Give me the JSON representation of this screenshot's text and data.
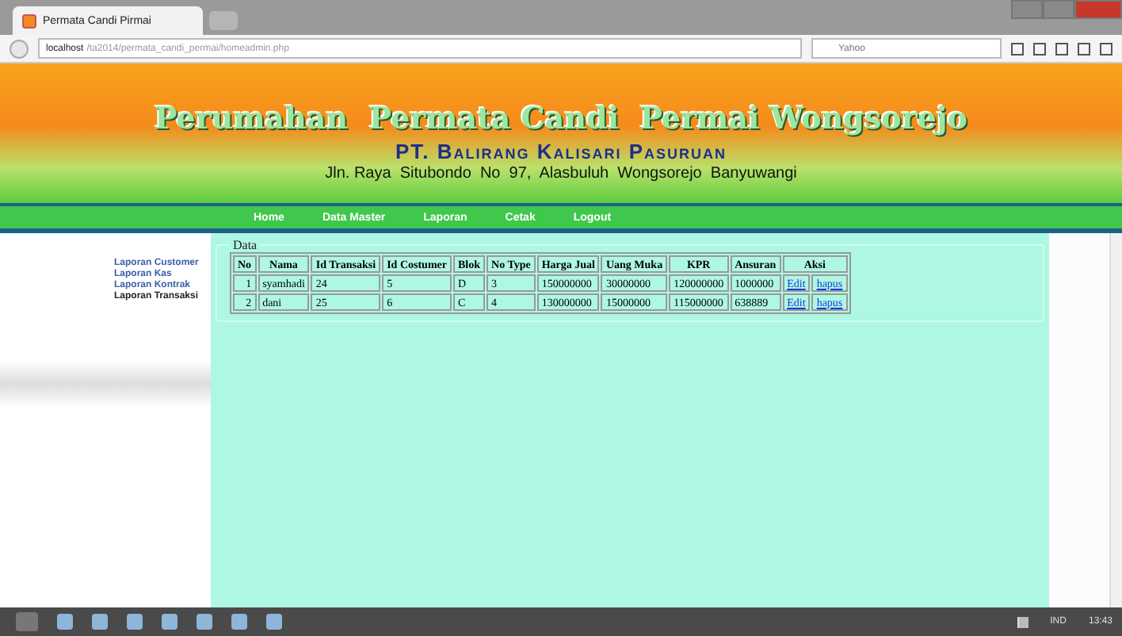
{
  "browser": {
    "tab_title": "Permata Candi Pirmai",
    "url_host": "localhost",
    "url_path": "/ta2014/permata_candi_permai/homeadmin.php",
    "search_placeholder": "Yahoo"
  },
  "banner": {
    "title": "Perumahan  Permata Candi  Permai Wongsorejo",
    "company": "PT. Balirang Kalisari Pasuruan",
    "address": "Jln. Raya  Situbondo  No  97,  Alasbuluh  Wongsorejo  Banyuwangi"
  },
  "nav": [
    "Home",
    "Data Master",
    "Laporan",
    "Cetak",
    "Logout"
  ],
  "sidebar": {
    "items": [
      {
        "label": "Laporan Customer",
        "selected": false
      },
      {
        "label": "Laporan Kas",
        "selected": false
      },
      {
        "label": "Laporan Kontrak",
        "selected": false
      },
      {
        "label": "Laporan Transaksi",
        "selected": true
      }
    ]
  },
  "panel": {
    "legend": "Data"
  },
  "table": {
    "columns": [
      "No",
      "Nama",
      "Id Transaksi",
      "Id Costumer",
      "Blok",
      "No Type",
      "Harga Jual",
      "Uang Muka",
      "KPR",
      "Ansuran",
      "Aksi"
    ],
    "rows": [
      {
        "cells": [
          "1",
          "syamhadi",
          "24",
          "5",
          "D",
          "3",
          "150000000",
          "30000000",
          "120000000",
          "1000000"
        ],
        "actions": [
          "Edit",
          "hapus"
        ]
      },
      {
        "cells": [
          "2",
          "dani",
          "25",
          "6",
          "C",
          "4",
          "130000000",
          "15000000",
          "115000000",
          "638889"
        ],
        "actions": [
          "Edit",
          "hapus"
        ]
      }
    ]
  },
  "taskbar": {
    "language": "IND",
    "clock": "13:43"
  }
}
